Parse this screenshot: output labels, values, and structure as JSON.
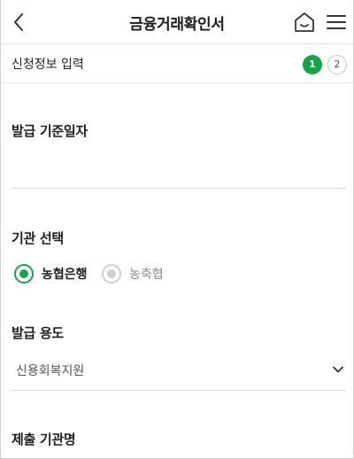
{
  "header": {
    "title": "금융거래확인서",
    "back_icon": "chevron-left-icon",
    "home_icon": "home-icon",
    "menu_icon": "hamburger-menu-icon"
  },
  "steps": {
    "label": "신청정보 입력",
    "current": "1",
    "next": "2",
    "accent_color": "#16a34a"
  },
  "form": {
    "issue_date_label": "발급 기준일자",
    "institution_label": "기관 선택",
    "institution_options": [
      "농협은행",
      "농축협"
    ],
    "institution_selected": "농협은행",
    "purpose_label": "발급 용도",
    "purpose_value": "신용회복지원",
    "submit_org_label": "제출 기관명"
  }
}
